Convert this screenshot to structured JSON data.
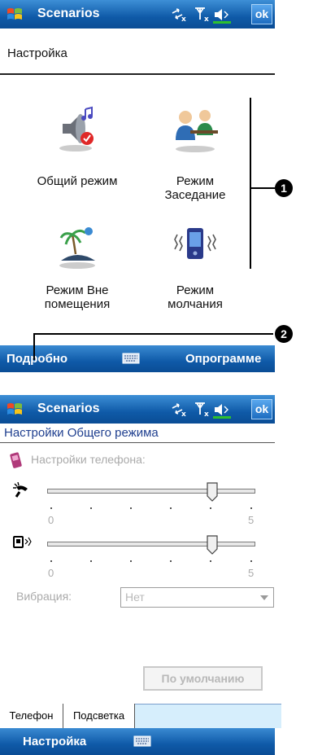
{
  "screen1": {
    "title": "Scenarios",
    "ok_label": "ok",
    "heading": "Настройка",
    "scenarios": [
      {
        "label_line1": "Общий режим",
        "label_line2": ""
      },
      {
        "label_line1": "Режим",
        "label_line2": "Заседание"
      },
      {
        "label_line1": "Режим Вне",
        "label_line2": "помещения"
      },
      {
        "label_line1": "Режим",
        "label_line2": "молчания"
      }
    ],
    "softkey_left": "Подробно",
    "softkey_right": "Опрограмме",
    "callouts": [
      "1",
      "2"
    ]
  },
  "screen2": {
    "title": "Scenarios",
    "ok_label": "ok",
    "heading": "Настройки Общего режима",
    "phone_settings_label": "Настройки телефона:",
    "ringer": {
      "min": "0",
      "max": "5",
      "level": 4
    },
    "volume": {
      "min": "0",
      "max": "5",
      "level": 4
    },
    "vibration_label": "Вибрация:",
    "vibration_value": "Нет",
    "default_button": "По умолчанию",
    "tabs": [
      "Телефон",
      "Подсветка"
    ],
    "softkey_left": "Настройка"
  },
  "colors": {
    "titlebar": "#0f5aa8",
    "tabstrip": "#d6eefc",
    "heading_blue": "#1f3f8f"
  }
}
